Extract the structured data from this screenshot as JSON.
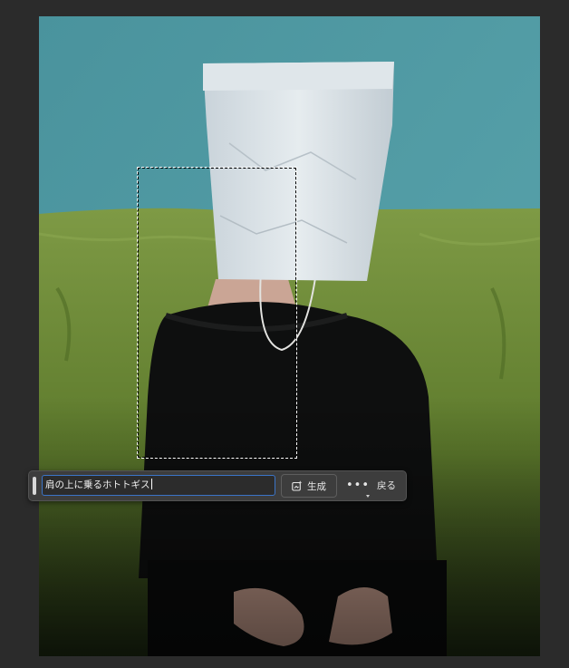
{
  "contextual_taskbar": {
    "prompt_value": "肩の上に乗るホトトギス",
    "generate_label": "生成",
    "more_label": "•••",
    "back_label": "戻る"
  },
  "icons": {
    "generate": "generative-fill-icon",
    "more": "more-options-icon",
    "grip": "drag-handle-icon"
  },
  "colors": {
    "workspace_bg": "#2b2b2b",
    "taskbar_bg": "#3d3d3d",
    "input_focus": "#3b74c7",
    "wall": "#4f9aa4",
    "sofa": "#6f8a3a"
  }
}
